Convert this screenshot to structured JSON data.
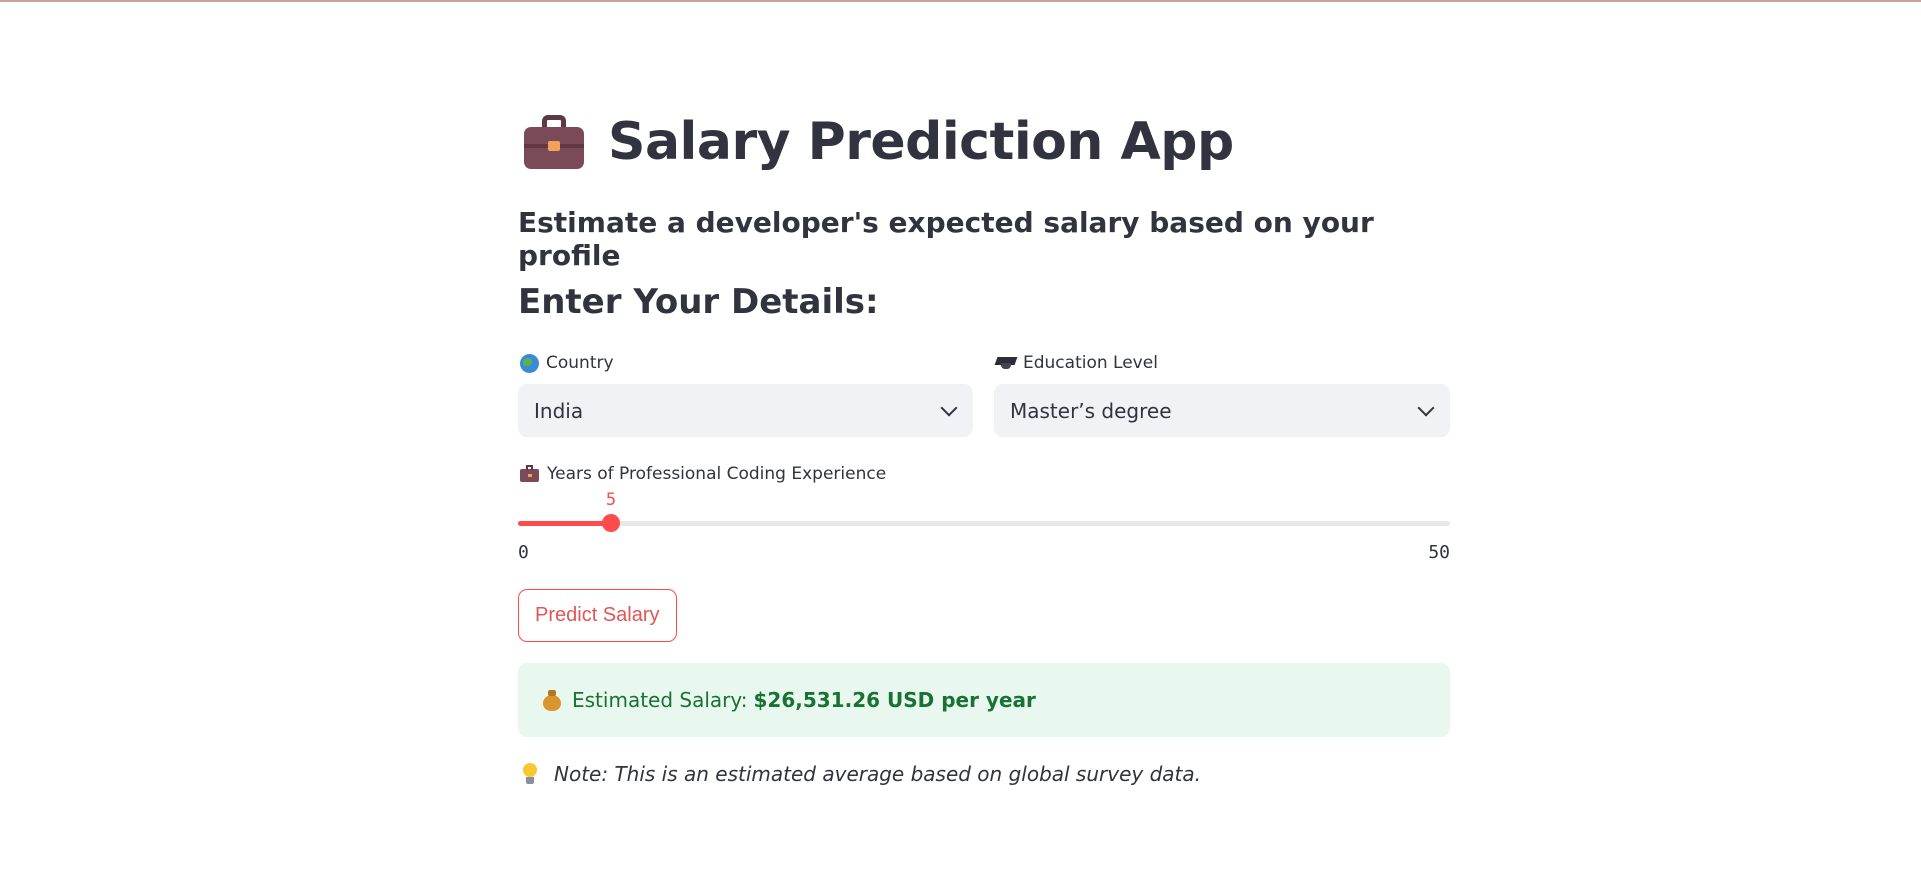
{
  "app": {
    "title": "Salary Prediction App",
    "subtitle": "Estimate a developer's expected salary based on your profile",
    "section_heading": "Enter Your Details:"
  },
  "form": {
    "country": {
      "label": "Country",
      "icon": "globe-icon",
      "selected": "India"
    },
    "education": {
      "label": "Education Level",
      "icon": "graduation-cap-icon",
      "selected": "Master’s degree"
    },
    "experience": {
      "label": "Years of Professional Coding Experience",
      "icon": "briefcase-icon",
      "value": 5,
      "value_label": "5",
      "min": 0,
      "max": 50,
      "min_label": "0",
      "max_label": "50"
    },
    "submit_label": "Predict Salary"
  },
  "result": {
    "prefix": "Estimated Salary:",
    "value": "$26,531.26 USD per year",
    "icon": "money-bag-icon"
  },
  "note": {
    "text": "Note: This is an estimated average based on global survey data.",
    "icon": "light-bulb-icon"
  },
  "colors": {
    "accent": "#ff4b4b",
    "success_bg": "#e9f8ee",
    "success_text": "#177233",
    "input_bg": "#f0f2f6",
    "text": "#31333f"
  }
}
